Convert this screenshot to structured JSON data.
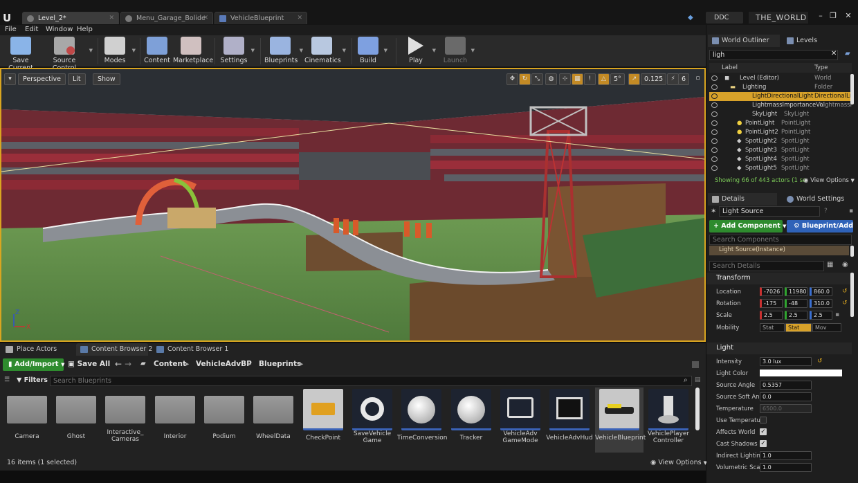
{
  "titlebar": {
    "tabs": [
      {
        "label": "Level_2*",
        "active": true
      },
      {
        "label": "Menu_Garage_Bolide",
        "active": false
      },
      {
        "label": "VehicleBlueprint",
        "active": false
      }
    ],
    "ddc_label": "DDC",
    "project_name": "THE_WORLD",
    "window_buttons": [
      "–",
      "❐",
      "✕"
    ]
  },
  "menu": [
    "File",
    "Edit",
    "Window",
    "Help"
  ],
  "toolbar": {
    "items": [
      {
        "label": "Save Current",
        "icon": "save-icon",
        "color": "#8ab4e8"
      },
      {
        "label": "Source Control",
        "icon": "source-control-icon",
        "color": "#c04848"
      },
      {
        "label": "Modes",
        "icon": "modes-icon",
        "color": "#d8d8d8"
      },
      {
        "label": "Content",
        "icon": "content-icon",
        "color": "#7ea0d8"
      },
      {
        "label": "Marketplace",
        "icon": "marketplace-icon",
        "color": "#d0c0c0"
      },
      {
        "label": "Settings",
        "icon": "settings-icon",
        "color": "#b0b0c8"
      },
      {
        "label": "Blueprints",
        "icon": "blueprints-icon",
        "color": "#9ab4e0"
      },
      {
        "label": "Cinematics",
        "icon": "cinematics-icon",
        "color": "#b8c8e0"
      },
      {
        "label": "Build",
        "icon": "build-icon",
        "color": "#7ea0e0"
      },
      {
        "label": "Play",
        "icon": "play-icon",
        "color": "#e0e0e0"
      },
      {
        "label": "Launch",
        "icon": "launch-icon",
        "color": "#808080"
      }
    ]
  },
  "viewport": {
    "perspective": "Perspective",
    "lit": "Lit",
    "show": "Show",
    "snap_angle": "5°",
    "snap_scale": "0.125",
    "camera_speed": "6"
  },
  "content_browser": {
    "tabs": [
      "Place Actors",
      "Content Browser 2",
      "Content Browser 1"
    ],
    "add_import": "Add/Import",
    "save_all": "Save All",
    "breadcrumb": [
      "Content",
      "VehicleAdvBP",
      "Blueprints"
    ],
    "filters": "Filters",
    "search_placeholder": "Search Blueprints",
    "assets": [
      {
        "name": "Camera",
        "kind": "folder"
      },
      {
        "name": "Ghost",
        "kind": "folder"
      },
      {
        "name": "Interactive_\nCameras",
        "kind": "folder"
      },
      {
        "name": "Interior",
        "kind": "folder"
      },
      {
        "name": "Podium",
        "kind": "folder"
      },
      {
        "name": "WheelData",
        "kind": "folder"
      },
      {
        "name": "CheckPoint",
        "kind": "blueprint"
      },
      {
        "name": "SaveVehicle\nGame",
        "kind": "blueprint"
      },
      {
        "name": "TimeConversion",
        "kind": "blueprint"
      },
      {
        "name": "Tracker",
        "kind": "blueprint"
      },
      {
        "name": "VehicleAdv\nGameMode",
        "kind": "blueprint"
      },
      {
        "name": "VehicleAdvHud",
        "kind": "blueprint"
      },
      {
        "name": "VehicleBlueprint",
        "kind": "blueprint",
        "selected": true
      },
      {
        "name": "VehiclePlayer\nController",
        "kind": "blueprint"
      }
    ],
    "status": "16 items (1 selected)",
    "view_options": "View Options"
  },
  "outliner": {
    "tab_outliner": "World Outliner",
    "tab_levels": "Levels",
    "search_value": "ligh",
    "col_label": "Label",
    "col_type": "Type",
    "rows": [
      {
        "label": "Level (Editor)",
        "type": "World"
      },
      {
        "label": "Lighting",
        "type": "Folder"
      },
      {
        "label": "LightDirectionalLight",
        "type": "DirectionalLi",
        "selected": true
      },
      {
        "label": "LightmassImportanceVol",
        "type": "LightmassIm"
      },
      {
        "label": "SkyLight",
        "type": "SkyLight"
      },
      {
        "label": "PointLight",
        "type": "PointLight"
      },
      {
        "label": "PointLight2",
        "type": "PointLight"
      },
      {
        "label": "SpotLight2",
        "type": "SpotLight"
      },
      {
        "label": "SpotLight3",
        "type": "SpotLight"
      },
      {
        "label": "SpotLight4",
        "type": "SpotLight"
      },
      {
        "label": "SpotLight5",
        "type": "SpotLight"
      }
    ],
    "status": "Showing 66 of 443 actors (1 se",
    "view_options": "View Options"
  },
  "details": {
    "tab_details": "Details",
    "tab_world": "World Settings",
    "actor_name": "Light Source",
    "add_component": "+ Add Component",
    "blueprint_add": "Blueprint/Add",
    "search_components": "Search Components",
    "component_instance": "Light Source(Instance)",
    "search_details": "Search Details",
    "transform_header": "Transform",
    "location_label": "Location",
    "location": [
      "-7026",
      "11980",
      "860.0"
    ],
    "rotation_label": "Rotation",
    "rotation": [
      "-175",
      "-48",
      "310.0"
    ],
    "scale_label": "Scale",
    "scale": [
      "2.5",
      "2.5",
      "2.5"
    ],
    "mobility_label": "Mobility",
    "mobility": [
      "Stat",
      "Stat",
      "Mov"
    ],
    "light_header": "Light",
    "intensity_label": "Intensity",
    "intensity": "3.0 lux",
    "light_color_label": "Light Color",
    "source_angle_label": "Source Angle",
    "source_angle": "0.5357",
    "source_soft_angle_label": "Source Soft Angle",
    "source_soft_angle": "0.0",
    "temperature_label": "Temperature",
    "temperature": "6500.0",
    "use_temperature_label": "Use Temperature",
    "affects_world_label": "Affects World",
    "cast_shadows_label": "Cast Shadows",
    "indirect_label": "Indirect Lighting I",
    "indirect": "1.0",
    "volumetric_label": "Volumetric Scatt",
    "volumetric": "1.0"
  }
}
